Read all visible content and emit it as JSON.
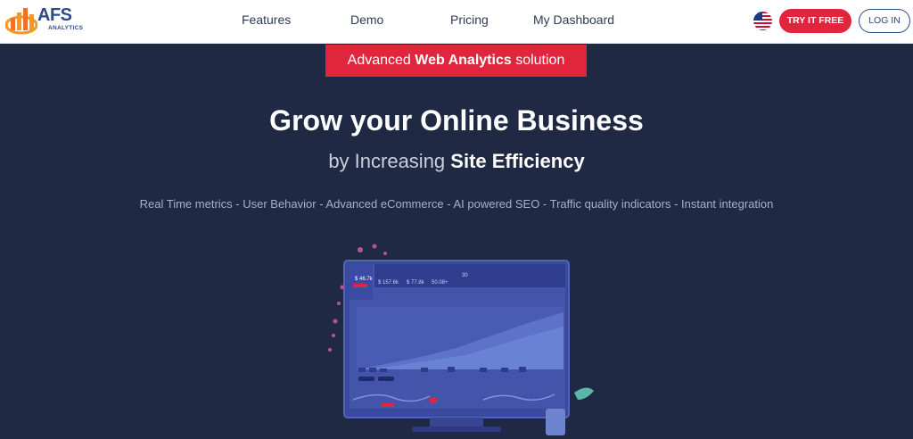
{
  "logo": {
    "name": "AFS",
    "sub": "ANALYTICS"
  },
  "nav": {
    "links": [
      "Features",
      "Demo",
      "Pricing",
      "My Dashboard"
    ]
  },
  "header_actions": {
    "language_flag": "us-flag-icon",
    "try_label": "TRY IT FREE",
    "login_label": "LOG IN"
  },
  "hero": {
    "banner_prefix": "Advanced",
    "banner_bold": "Web Analytics",
    "banner_suffix": "solution",
    "headline": "Grow your Online Business",
    "sub_prefix": "by Increasing",
    "sub_bold": "Site Efficiency",
    "features": "Real Time metrics - User Behavior - Advanced eCommerce - AI powered SEO - Traffic quality indicators - Instant integration"
  },
  "colors": {
    "brand_red": "#e0263c",
    "brand_blue": "#2b4a8b",
    "hero_bg": "#1f2944"
  }
}
